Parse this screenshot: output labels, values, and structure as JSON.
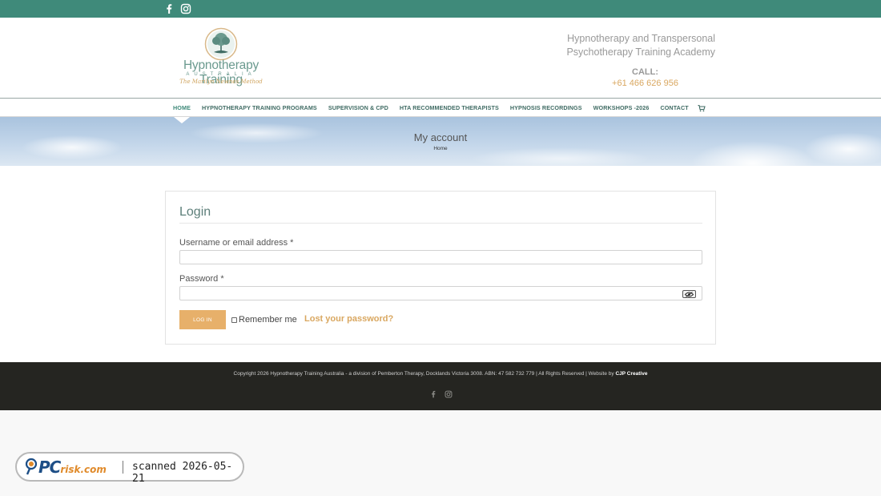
{
  "header": {
    "logo_name": "Hypnotherapy Training",
    "logo_country": "AUSTRALIA",
    "logo_tagline": "The Marilyn Newnes Method",
    "tagline_line1": "Hypnotherapy and Transpersonal",
    "tagline_line2": "Psychotherapy Training Academy",
    "call_label": "CALL:",
    "phone": "+61 466 626 956"
  },
  "social": {
    "facebook_icon": "facebook-icon",
    "instagram_icon": "instagram-icon"
  },
  "nav": {
    "items": [
      {
        "label": "HOME"
      },
      {
        "label": "HYPNOTHERAPY TRAINING PROGRAMS"
      },
      {
        "label": "SUPERVISION & CPD"
      },
      {
        "label": "HTA RECOMMENDED THERAPISTS"
      },
      {
        "label": "HYPNOSIS RECORDINGS"
      },
      {
        "label": "WORKSHOPS -2026"
      },
      {
        "label": "CONTACT"
      }
    ],
    "cart_icon": "cart-icon"
  },
  "banner": {
    "title": "My account",
    "breadcrumb": "Home"
  },
  "login": {
    "title": "Login",
    "username_label": "Username or email address *",
    "username_value": "",
    "password_label": "Password *",
    "password_value": "",
    "button_label": "LOG IN",
    "remember_label": "Remember me",
    "lost_password": "Lost your password?"
  },
  "footer": {
    "copyright": "Copyright 2026 Hypnotherapy Training Australia - a division of Pemberton Therapy, Docklands Victoria 3008. ABN: 47 582 732 779 | All Rights Reserved | Website by ",
    "credit": "CJP Creative"
  },
  "watermark": {
    "brand_main": "PC",
    "brand_rest": "risk.com",
    "text": "scanned 2026-05-21"
  },
  "colors": {
    "teal": "#3f8a7a",
    "accent": "#e7b06a",
    "footer_bg": "#252521"
  }
}
